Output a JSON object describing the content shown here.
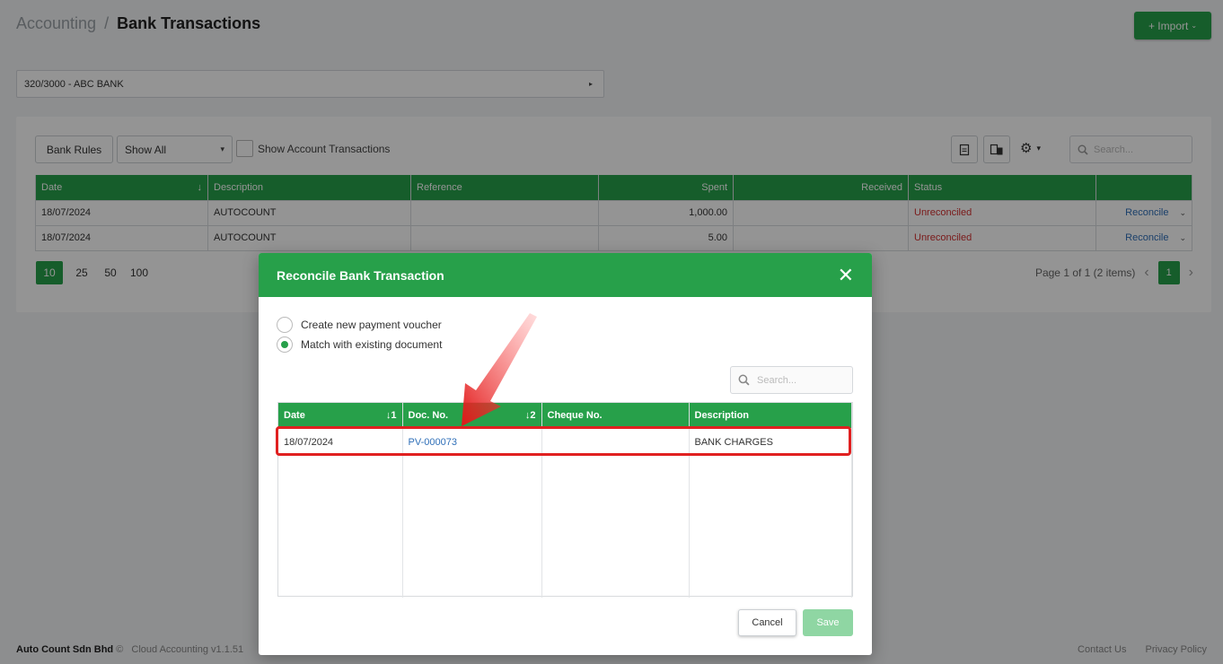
{
  "header": {
    "parent": "Accounting",
    "separator": "/",
    "title": "Bank Transactions",
    "import_label": "+ Import"
  },
  "bank_account": {
    "selected": "320/3000 - ABC BANK"
  },
  "toolbar": {
    "bank_rules": "Bank Rules",
    "filter_selected": "Show All",
    "show_account_transactions": "Show Account Transactions",
    "search_placeholder": "Search..."
  },
  "transactions": {
    "columns": [
      "Date",
      "Description",
      "Reference",
      "Spent",
      "Received",
      "Status"
    ],
    "rows": [
      {
        "date": "18/07/2024",
        "description": "AUTOCOUNT",
        "reference": "",
        "spent": "1,000.00",
        "received": "",
        "status": "Unreconciled",
        "action": "Reconcile"
      },
      {
        "date": "18/07/2024",
        "description": "AUTOCOUNT",
        "reference": "",
        "spent": "5.00",
        "received": "",
        "status": "Unreconciled",
        "action": "Reconcile"
      }
    ]
  },
  "pagination": {
    "sizes": [
      "10",
      "25",
      "50",
      "100"
    ],
    "active_size": "10",
    "info": "Page 1 of 1 (2 items)",
    "current_page": "1"
  },
  "footer": {
    "company": "Auto Count Sdn Bhd",
    "copyright": "©",
    "version": "Cloud Accounting v1.1.51",
    "contact": "Contact Us",
    "privacy": "Privacy Policy"
  },
  "modal": {
    "title": "Reconcile Bank Transaction",
    "options": [
      "Create new payment voucher",
      "Match with existing document"
    ],
    "selected_option": 1,
    "search_placeholder": "Search...",
    "columns": [
      {
        "label": "Date",
        "sort": "↓1"
      },
      {
        "label": "Doc. No.",
        "sort": "↓2"
      },
      {
        "label": "Cheque No.",
        "sort": ""
      },
      {
        "label": "Description",
        "sort": ""
      }
    ],
    "rows": [
      {
        "date": "18/07/2024",
        "doc_no": "PV-000073",
        "cheque_no": "",
        "description": "BANK CHARGES"
      }
    ],
    "cancel_label": "Cancel",
    "save_label": "Save"
  },
  "colors": {
    "primary": "#27a04a",
    "unreconciled": "#d32f2f",
    "link": "#2f6fb8",
    "highlight": "#e02020"
  }
}
